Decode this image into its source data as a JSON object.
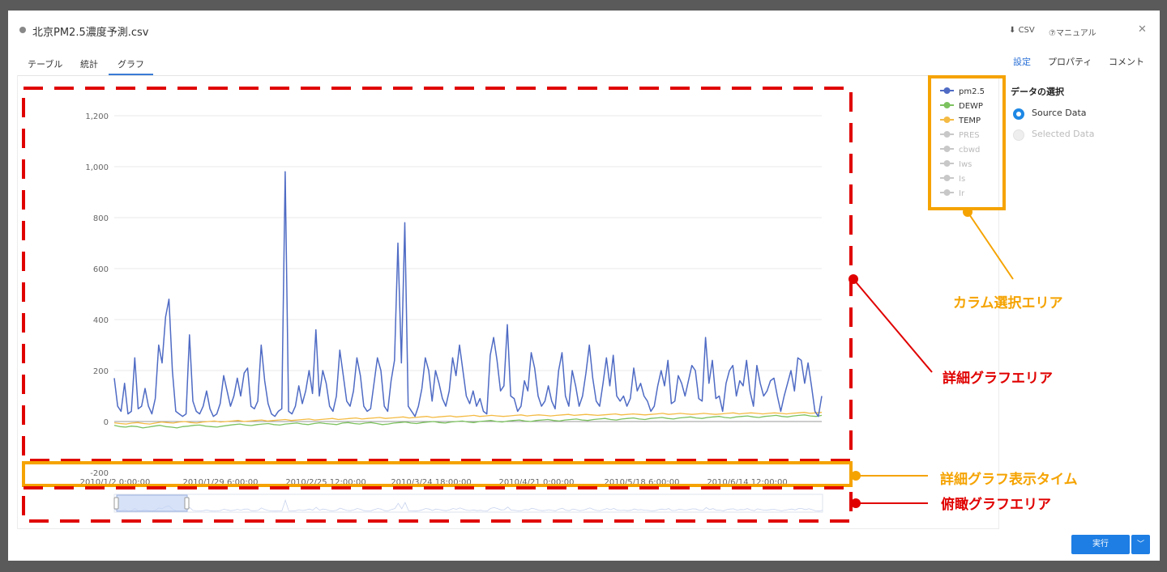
{
  "header": {
    "title": "北京PM2.5濃度予測.csv",
    "csv_label": "CSV",
    "manual_label": "⑦マニュアル",
    "close_icon": "close-icon"
  },
  "tabs": [
    {
      "label": "テーブル",
      "active": false
    },
    {
      "label": "統計",
      "active": false
    },
    {
      "label": "グラフ",
      "active": true
    }
  ],
  "right_tabs": [
    {
      "label": "設定",
      "active": true
    },
    {
      "label": "プロパティ",
      "active": false
    },
    {
      "label": "コメント",
      "active": false
    }
  ],
  "settings": {
    "section_title": "データの選択",
    "options": [
      {
        "label": "Source Data",
        "selected": true
      },
      {
        "label": "Selected Data",
        "selected": false
      }
    ]
  },
  "run_button": {
    "label": "実行"
  },
  "annotations": {
    "column_area": "カラム選択エリア",
    "detail_area": "詳細グラフエリア",
    "time_area": "詳細グラフ表示タイム",
    "overview_area": "俯瞰グラフエリア"
  },
  "colors": {
    "accent": "#1e7ee4",
    "annot_red": "#e00000",
    "annot_orange": "#f5a300",
    "pm25": "#4f6bc4",
    "dewp": "#7cc25f",
    "temp": "#f4bb44",
    "inactive": "#c8c8c8"
  },
  "chart_data": {
    "type": "line",
    "y_ticks": [
      "1,200",
      "1,000",
      "800",
      "600",
      "400",
      "200",
      "0",
      "-200"
    ],
    "y_tick_values": [
      1200,
      1000,
      800,
      600,
      400,
      200,
      0,
      -200
    ],
    "ylim": [
      -200,
      1200
    ],
    "x_labels": [
      "2010/1/2 0:00:00",
      "2010/1/29 6:00:00",
      "2010/2/25 12:00:00",
      "2010/3/24 18:00:00",
      "2010/4/21 0:00:00",
      "2010/5/18 6:00:00",
      "2010/6/14 12:00:00"
    ],
    "legend": [
      {
        "name": "pm2.5",
        "active": true,
        "color": "#4f6bc4"
      },
      {
        "name": "DEWP",
        "active": true,
        "color": "#7cc25f"
      },
      {
        "name": "TEMP",
        "active": true,
        "color": "#f4bb44"
      },
      {
        "name": "PRES",
        "active": false,
        "color": "#c8c8c8"
      },
      {
        "name": "cbwd",
        "active": false,
        "color": "#c8c8c8"
      },
      {
        "name": "Iws",
        "active": false,
        "color": "#c8c8c8"
      },
      {
        "name": "Is",
        "active": false,
        "color": "#c8c8c8"
      },
      {
        "name": "Ir",
        "active": false,
        "color": "#c8c8c8"
      }
    ],
    "series": [
      {
        "name": "pm2.5",
        "values": [
          170,
          60,
          40,
          150,
          30,
          40,
          250,
          50,
          60,
          130,
          60,
          30,
          90,
          300,
          230,
          410,
          480,
          200,
          40,
          30,
          20,
          30,
          340,
          80,
          40,
          30,
          60,
          120,
          50,
          20,
          30,
          70,
          180,
          120,
          60,
          100,
          170,
          100,
          190,
          210,
          60,
          50,
          80,
          300,
          160,
          70,
          30,
          20,
          40,
          50,
          980,
          40,
          30,
          60,
          140,
          70,
          120,
          200,
          110,
          360,
          100,
          200,
          150,
          60,
          40,
          100,
          280,
          180,
          80,
          60,
          120,
          250,
          180,
          60,
          40,
          50,
          150,
          250,
          200,
          60,
          40,
          160,
          240,
          700,
          230,
          780,
          60,
          40,
          20,
          60,
          130,
          250,
          200,
          80,
          200,
          150,
          90,
          60,
          120,
          250,
          180,
          300,
          200,
          100,
          70,
          120,
          60,
          90,
          40,
          30,
          260,
          330,
          240,
          120,
          140,
          380,
          100,
          90,
          40,
          60,
          160,
          120,
          270,
          210,
          100,
          60,
          80,
          140,
          80,
          50,
          200,
          270,
          100,
          60,
          200,
          140,
          60,
          100,
          190,
          300,
          170,
          80,
          60,
          150,
          250,
          140,
          260,
          100,
          80,
          100,
          60,
          90,
          210,
          120,
          150,
          100,
          80,
          40,
          60,
          140,
          200,
          140,
          240,
          70,
          80,
          180,
          150,
          100,
          160,
          220,
          200,
          90,
          80,
          330,
          150,
          240,
          90,
          100,
          40,
          150,
          200,
          220,
          100,
          160,
          140,
          240,
          120,
          60,
          220,
          150,
          100,
          120,
          160,
          170,
          100,
          40,
          100,
          150,
          200,
          120,
          250,
          240,
          150,
          230,
          140,
          40,
          20,
          100
        ]
      },
      {
        "name": "DEWP",
        "values": [
          -15,
          -20,
          -22,
          -18,
          -20,
          -25,
          -22,
          -18,
          -15,
          -20,
          -22,
          -25,
          -20,
          -18,
          -15,
          -14,
          -18,
          -20,
          -22,
          -18,
          -15,
          -12,
          -10,
          -14,
          -16,
          -12,
          -10,
          -8,
          -12,
          -14,
          -10,
          -8,
          -6,
          -10,
          -12,
          -8,
          -5,
          -8,
          -10,
          -12,
          -6,
          -4,
          -8,
          -10,
          -6,
          -4,
          -8,
          -12,
          -10,
          -6,
          -4,
          -2,
          -6,
          -8,
          -4,
          -2,
          0,
          -4,
          -6,
          -2,
          0,
          2,
          -2,
          -4,
          0,
          2,
          4,
          0,
          -2,
          2,
          4,
          6,
          2,
          0,
          4,
          6,
          8,
          4,
          2,
          6,
          8,
          10,
          6,
          4,
          8,
          10,
          12,
          8,
          6,
          10,
          12,
          14,
          10,
          8,
          12,
          14,
          16,
          12,
          10,
          14,
          16,
          18,
          14,
          12,
          16,
          18,
          20,
          16,
          14,
          18,
          20,
          22,
          18,
          16,
          20,
          22,
          24,
          20,
          18,
          22,
          24,
          26,
          22,
          20,
          24
        ]
      },
      {
        "name": "TEMP",
        "values": [
          -5,
          -8,
          -10,
          -6,
          -4,
          -8,
          -10,
          -6,
          -2,
          -4,
          -6,
          -2,
          0,
          -4,
          -6,
          -2,
          0,
          2,
          -2,
          0,
          2,
          4,
          0,
          2,
          4,
          6,
          2,
          4,
          6,
          8,
          4,
          6,
          8,
          10,
          6,
          8,
          10,
          12,
          8,
          10,
          12,
          14,
          10,
          12,
          14,
          16,
          12,
          14,
          16,
          18,
          14,
          16,
          18,
          20,
          16,
          18,
          20,
          22,
          18,
          20,
          22,
          24,
          20,
          22,
          24,
          22,
          20,
          22,
          24,
          26,
          22,
          24,
          26,
          24,
          22,
          24,
          26,
          28,
          24,
          26,
          28,
          26,
          24,
          26,
          28,
          30,
          26,
          28,
          30,
          28,
          26,
          28,
          30,
          32,
          28,
          30,
          32,
          30,
          28,
          30,
          32,
          30,
          28,
          30,
          32,
          34,
          30,
          32,
          34,
          32,
          30,
          32,
          34,
          32,
          30,
          32,
          34,
          36,
          32,
          34,
          36
        ]
      }
    ]
  }
}
